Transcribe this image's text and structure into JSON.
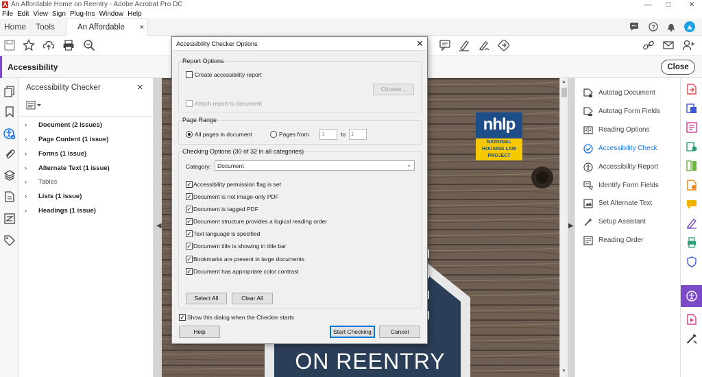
{
  "window": {
    "title": "An Affordable Home on Reentry - Adobe Acrobat Pro DC",
    "controls": {
      "minimize": "—",
      "maximize": "□",
      "close": "✕"
    }
  },
  "menubar": [
    "File",
    "Edit",
    "View",
    "Sign",
    "Plug-Ins",
    "Window",
    "Help"
  ],
  "tabs": {
    "home": "Home",
    "tools": "Tools",
    "document": "An Affordable Hom...",
    "document_close": "×"
  },
  "accessibility_bar": {
    "label": "Accessibility",
    "close_label": "Close"
  },
  "checker": {
    "title": "Accessibility Checker",
    "close": "×",
    "rows": [
      {
        "label": "Document (2 issues)",
        "bold": true
      },
      {
        "label": "Page Content (1 issue)",
        "bold": true
      },
      {
        "label": "Forms (1 issue)",
        "bold": true
      },
      {
        "label": "Alternate Text (1 issue)",
        "bold": true
      },
      {
        "label": "Tables",
        "bold": false
      },
      {
        "label": "Lists (1 issue)",
        "bold": true
      },
      {
        "label": "Headings (1 issue)",
        "bold": true
      }
    ]
  },
  "right_tools": [
    {
      "label": "Autotag Document",
      "icon": "autotag-icon"
    },
    {
      "label": "Autotag Form Fields",
      "icon": "autotag-form-icon"
    },
    {
      "label": "Reading Options",
      "icon": "reading-options-icon"
    },
    {
      "label": "Accessibility Check",
      "icon": "check-circle-icon",
      "active": true
    },
    {
      "label": "Accessibility Report",
      "icon": "accessibility-report-icon"
    },
    {
      "label": "Identify Form Fields",
      "icon": "form-fields-icon"
    },
    {
      "label": "Set Alternate Text",
      "icon": "alt-text-icon"
    },
    {
      "label": "Setup Assistant",
      "icon": "wand-icon"
    },
    {
      "label": "Reading Order",
      "icon": "reading-order-icon"
    }
  ],
  "document_page": {
    "logo_text": "nhlp",
    "logo_sub": [
      "NATIONAL",
      "HOUSING LAW",
      "PROJECT"
    ],
    "banner": "ON REENTRY"
  },
  "dialog": {
    "title": "Accessibility Checker Options",
    "close": "✕",
    "report_options": {
      "legend": "Report Options",
      "create_report": {
        "label": "Create accessibility report",
        "checked": false
      },
      "choose_button": "Choose...",
      "attach_report": {
        "label": "Attach report to document",
        "checked": false,
        "disabled": true
      }
    },
    "page_range": {
      "legend": "Page Range",
      "all_pages": "All pages in document",
      "pages_from": "Pages from",
      "from_value": "1",
      "to_label": "to",
      "to_value": "1",
      "selected": "all"
    },
    "checking_options": {
      "legend": "Checking Options (30 of 32 in all categories)",
      "category_label": "Category:",
      "category_value": "Document",
      "items": [
        {
          "label": "Accessibility permission flag is set",
          "checked": true
        },
        {
          "label": "Document is not image-only PDF",
          "checked": true
        },
        {
          "label": "Document is tagged PDF",
          "checked": true
        },
        {
          "label": "Document structure provides a logical reading order",
          "checked": true
        },
        {
          "label": "Text language is specified",
          "checked": true
        },
        {
          "label": "Document title is showing in title bar",
          "checked": true
        },
        {
          "label": "Bookmarks are present in large documents",
          "checked": true
        },
        {
          "label": "Document has appropriate color contrast",
          "checked": true
        }
      ],
      "select_all": "Select All",
      "clear_all": "Clear All"
    },
    "show_dialog": {
      "label": "Show this dialog when the Checker starts",
      "checked": true
    },
    "help_button": "Help",
    "start_button": "Start Checking",
    "cancel_button": "Cancel"
  },
  "colors": {
    "accent": "#7b4bc7",
    "tool_active": "#1473e6",
    "logo_blue": "#1d4e89",
    "logo_yellow": "#f6c800"
  }
}
